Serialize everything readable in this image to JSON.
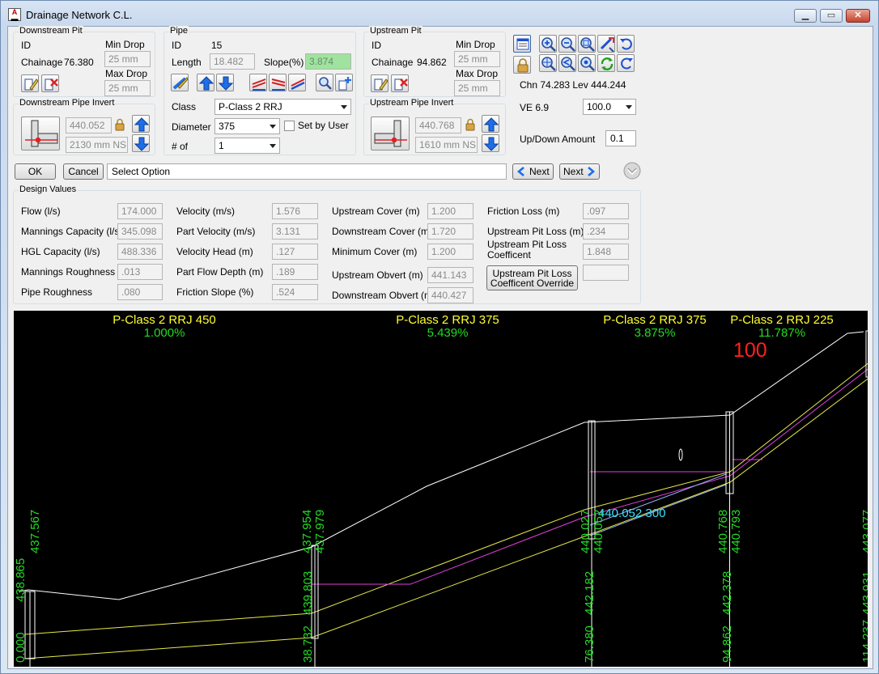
{
  "window": {
    "title": "Drainage Network C.L."
  },
  "downstream_pit": {
    "caption": "Downstream Pit",
    "id_label": "ID",
    "chainage_label": "Chainage",
    "chainage": "76.380",
    "min_drop_label": "Min Drop",
    "min_drop": "25 mm",
    "max_drop_label": "Max Drop",
    "max_drop": "25 mm"
  },
  "downstream_invert": {
    "caption": "Downstream Pipe Invert",
    "level": "440.052",
    "ns": "2130 mm NS"
  },
  "pipe": {
    "caption": "Pipe",
    "id_label": "ID",
    "id": "15",
    "length_label": "Length",
    "length": "18.482",
    "slope_label": "Slope(%)",
    "slope": "3.874",
    "class_label": "Class",
    "class_value": "P-Class 2 RRJ",
    "diameter_label": "Diameter",
    "diameter": "375",
    "set_by_user_label": "Set by User",
    "number_label": "# of",
    "number": "1"
  },
  "upstream_pit": {
    "caption": "Upstream Pit",
    "id_label": "ID",
    "chainage_label": "Chainage",
    "chainage": "94.862",
    "min_drop_label": "Min Drop",
    "min_drop": "25 mm",
    "max_drop_label": "Max Drop",
    "max_drop": "25 mm"
  },
  "upstream_invert": {
    "caption": "Upstream Pipe Invert",
    "level": "440.768",
    "ns": "1610 mm NS"
  },
  "view": {
    "readout": "Chn 74.283 Lev 444.244",
    "ve_label": "VE 6.9",
    "ve_value": "100.0",
    "updown_label": "Up/Down Amount",
    "updown_value": "0.1"
  },
  "actions": {
    "ok": "OK",
    "cancel": "Cancel",
    "prompt": "Select Option",
    "prev_next": "Next",
    "next": "Next"
  },
  "design": {
    "caption": "Design Values",
    "col1": [
      {
        "label": "Flow (l/s)",
        "value": "174.000"
      },
      {
        "label": "Mannings Capacity (l/s)",
        "value": "345.098"
      },
      {
        "label": "HGL Capacity (l/s)",
        "value": "488.336"
      },
      {
        "label": "Mannings Roughness",
        "value": ".013"
      },
      {
        "label": "Pipe Roughness",
        "value": ".080"
      }
    ],
    "col2": [
      {
        "label": "Velocity (m/s)",
        "value": "1.576"
      },
      {
        "label": "Part Velocity (m/s)",
        "value": "3.131"
      },
      {
        "label": "Velocity Head (m)",
        "value": ".127"
      },
      {
        "label": "Part Flow Depth (m)",
        "value": ".189"
      },
      {
        "label": "Friction Slope (%)",
        "value": ".524"
      }
    ],
    "col3": [
      {
        "label": "Upstream Cover (m)",
        "value": "1.200"
      },
      {
        "label": "Downstream Cover (m)",
        "value": "1.720"
      },
      {
        "label": "Minimum Cover (m)",
        "value": "1.200"
      },
      {
        "label": "Upstream Obvert (m)",
        "value": "441.143"
      },
      {
        "label": "Downstream Obvert (m)",
        "value": "440.427"
      }
    ],
    "col4": [
      {
        "label": "Friction Loss (m)",
        "value": ".097"
      },
      {
        "label": "Upstream Pit Loss (m)",
        "value": ".234"
      },
      {
        "label_line1": "Upstream Pit Loss",
        "label_line2": "Coefficent",
        "value": "1.848"
      }
    ],
    "override_line1": "Upstream Pit Loss",
    "override_line2": "Coefficent Override",
    "override_value": ""
  },
  "profile": {
    "segments": [
      {
        "class": "P-Class 2 RRJ 450",
        "grade": "1.000%"
      },
      {
        "class": "P-Class 2 RRJ 375",
        "grade": "5.439%"
      },
      {
        "class": "P-Class 2 RRJ 375",
        "grade": "3.875%"
      },
      {
        "class": "P-Class 2 RRJ 225",
        "grade": "11.787%"
      }
    ],
    "scale": "100",
    "pointer_label": "440.052 300",
    "pits": [
      {
        "chainage": "0.000",
        "lower_level": "438.865",
        "upper_level": "437.567"
      },
      {
        "chainage": "38.732",
        "lower_level": "439.803",
        "upper_level": "437.954",
        "upper_level_2": "437.979"
      },
      {
        "chainage": "76.380",
        "lower_level": "442.182",
        "upper_level": "440.027",
        "upper_level_2": "440.052"
      },
      {
        "chainage": "94.862",
        "lower_level": "442.378",
        "upper_level": "440.768",
        "upper_level_2": "440.793"
      },
      {
        "chainage": "114.237",
        "lower_level": "443.931",
        "upper_level": "443.077"
      }
    ]
  },
  "colors": {
    "ground_line": "#ffffff",
    "pipe_line": "#e8e84a",
    "hgl_line": "#e040e0",
    "selected_pipe": "#9bb8ff",
    "label_green": "#22dd22",
    "label_yellow": "#ffff33",
    "scale_red": "#ff2020",
    "pointer_cyan": "#3ee0ff"
  }
}
